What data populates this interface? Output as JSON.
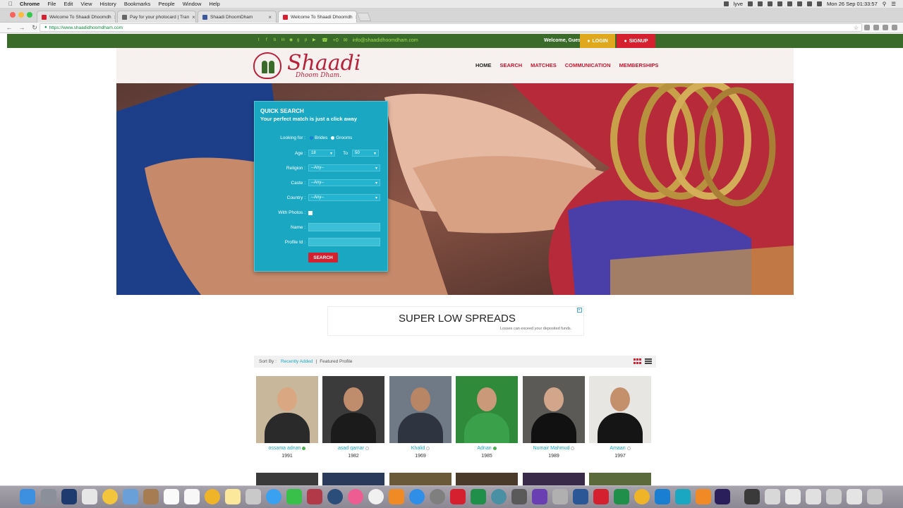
{
  "menubar": {
    "app": "Chrome",
    "items": [
      "File",
      "Edit",
      "View",
      "History",
      "Bookmarks",
      "People",
      "Window",
      "Help"
    ],
    "clock": "Mon 26 Sep  01:33:57",
    "lyve": "lyve"
  },
  "tabs": [
    {
      "title": "Welcome To Shaadi Dhoomdh",
      "active": false,
      "color": "#d5202f"
    },
    {
      "title": "Pay for your photocard | Tran",
      "active": false,
      "color": "#666666"
    },
    {
      "title": "Shaadi DhoomDham",
      "active": false,
      "color": "#3b5998"
    },
    {
      "title": "Welcome To Shaadi Dhoomdh",
      "active": true,
      "color": "#d5202f"
    }
  ],
  "address": {
    "url": "https://www.shaadidhoomdham.com"
  },
  "topbar": {
    "phone": "+0",
    "email": "info@shaadidhoomdham.com",
    "welcome": "Welcome, Guest",
    "login": "LOGIN",
    "signup": "SIGNUP"
  },
  "logo": {
    "brand": "Shaadi",
    "sub": "Dhoom Dham."
  },
  "nav": {
    "home": "HOME",
    "search": "SEARCH",
    "matches": "MATCHES",
    "communication": "COMMUNICATION",
    "memberships": "MEMBERSHIPS"
  },
  "quick_search": {
    "title": "QUICK SEARCH",
    "subtitle": "Your perfect match is just a click away",
    "looking_for_label": "Looking for :",
    "brides": "Brides",
    "grooms": "Grooms",
    "age_label": "Age :",
    "age_from": "18",
    "age_to_label": "To",
    "age_to": "50",
    "religion_label": "Religion :",
    "religion_value": "--Any--",
    "caste_label": "Caste :",
    "caste_value": "--Any--",
    "country_label": "Country :",
    "country_value": "--Any--",
    "with_photos_label": "With Photos :",
    "name_label": "Name :",
    "profile_id_label": "Profile Id :",
    "search_button": "SEARCH"
  },
  "ad": {
    "title": "SUPER LOW SPREADS",
    "subtitle": "Losses can exceed your deposited funds."
  },
  "sort": {
    "label": "Sort By :",
    "recently_added": "Recently Added",
    "featured": "Featured Profile"
  },
  "profiles": [
    {
      "name": "ossama adnan",
      "year": "1991",
      "online": true,
      "bg": "#c9b79c",
      "skin": "#d9a882",
      "cloth": "#2a2a2a"
    },
    {
      "name": "asad qamar",
      "year": "1982",
      "online": false,
      "bg": "#3b3b3b",
      "skin": "#c08d6c",
      "cloth": "#1b1b1b"
    },
    {
      "name": "Khalid",
      "year": "1969",
      "online": false,
      "bg": "#6f7a86",
      "skin": "#b88565",
      "cloth": "#2e3440"
    },
    {
      "name": "Adnan",
      "year": "1985",
      "online": true,
      "bg": "#2f8a3a",
      "skin": "#c9997a",
      "cloth": "#3aa04a"
    },
    {
      "name": "Numair Mahmud",
      "year": "1989",
      "online": false,
      "bg": "#5c5a57",
      "skin": "#d2a68a",
      "cloth": "#111111"
    },
    {
      "name": "Amaan",
      "year": "1997",
      "online": false,
      "bg": "#e8e6e2",
      "skin": "#c4906c",
      "cloth": "#151515"
    }
  ]
}
